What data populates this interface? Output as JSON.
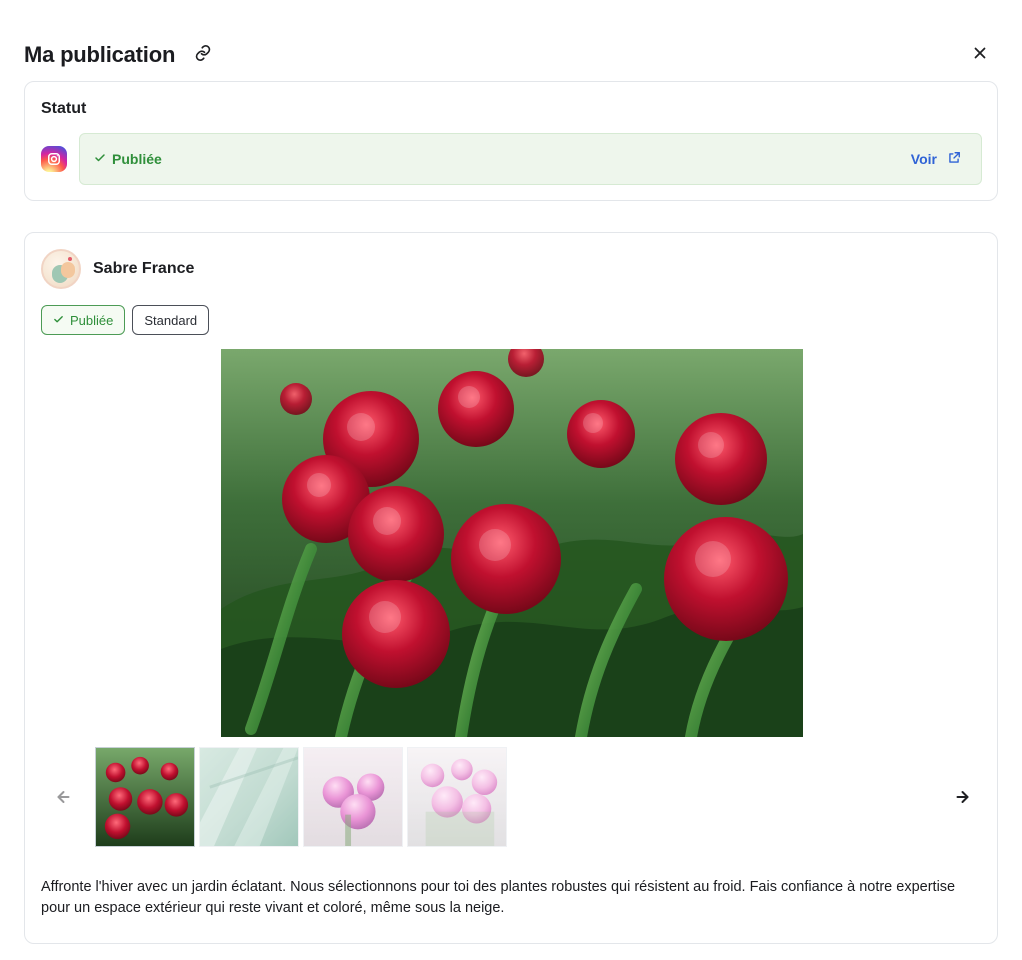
{
  "header": {
    "title": "Ma publication"
  },
  "status": {
    "section_title": "Statut",
    "network_icon": "instagram-icon",
    "state_label": "Publiée",
    "view_label": "Voir",
    "colors": {
      "success": "#2f8f3a",
      "success_bg": "#eef6ec",
      "link": "#2f63d6"
    }
  },
  "post": {
    "account_name": "Sabre France",
    "pills": [
      {
        "label": "Publiée",
        "icon": "check-icon"
      },
      {
        "label": "Standard"
      }
    ],
    "media": {
      "main_image": "red-peonies-photo",
      "thumbnails": [
        {
          "name": "red-peonies-thumbnail",
          "selected": true
        },
        {
          "name": "agave-leaves-thumbnail"
        },
        {
          "name": "pink-cyclamen-thumbnail"
        },
        {
          "name": "light-pink-cyclamen-thumbnail"
        }
      ]
    },
    "caption": "Affronte l'hiver avec un jardin éclatant. Nous sélectionnons pour toi des plantes robustes qui résistent au froid. Fais confiance à notre expertise pour un espace extérieur qui reste vivant et coloré, même sous la neige."
  }
}
